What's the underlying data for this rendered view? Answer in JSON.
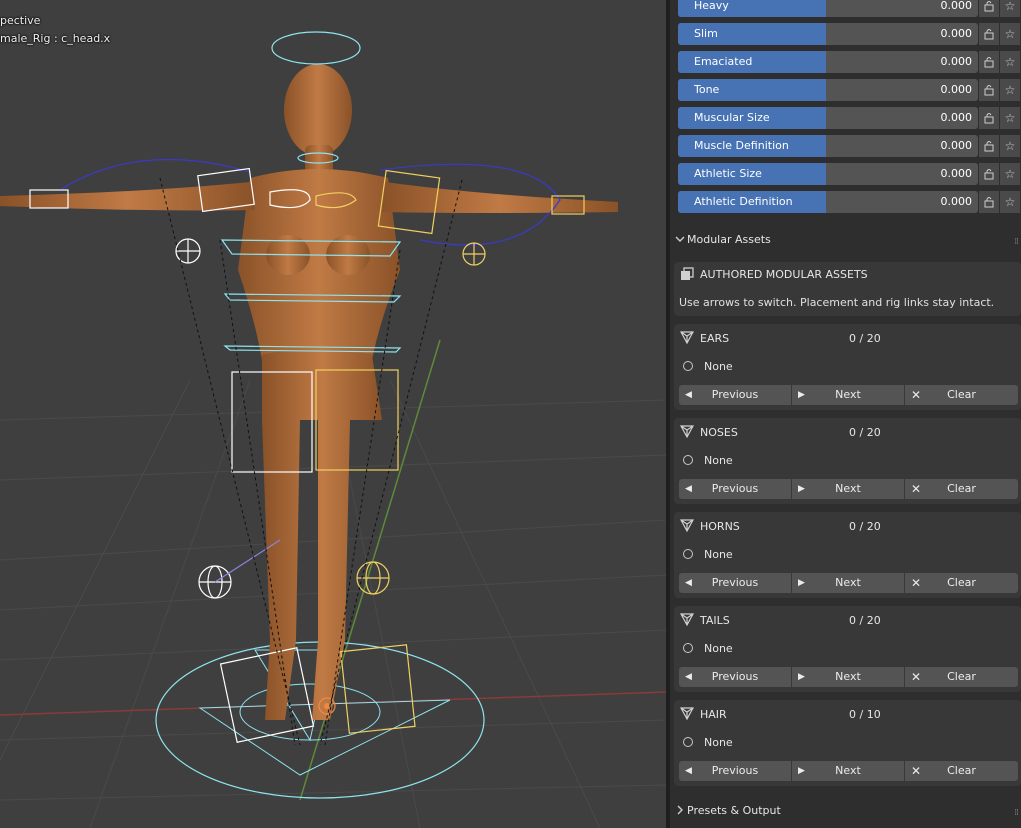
{
  "viewport": {
    "overlay_line1": "pective",
    "overlay_line2": "male_Rig : c_head.x"
  },
  "shape_sliders": [
    {
      "label": "Heavy",
      "value": "0.000"
    },
    {
      "label": "Slim",
      "value": "0.000"
    },
    {
      "label": "Emaciated",
      "value": "0.000"
    },
    {
      "label": "Tone",
      "value": "0.000"
    },
    {
      "label": "Muscular Size",
      "value": "0.000"
    },
    {
      "label": "Muscle Definition",
      "value": "0.000"
    },
    {
      "label": "Athletic Size",
      "value": "0.000"
    },
    {
      "label": "Athletic Definition",
      "value": "0.000"
    }
  ],
  "modular": {
    "header": "Modular Assets",
    "info_title": "AUTHORED MODULAR ASSETS",
    "info_text": "Use arrows to switch. Placement and rig links stay intact.",
    "categories": [
      {
        "name": "EARS",
        "count": "0 / 20",
        "selected": "None"
      },
      {
        "name": "NOSES",
        "count": "0 / 20",
        "selected": "None"
      },
      {
        "name": "HORNS",
        "count": "0 / 20",
        "selected": "None"
      },
      {
        "name": "TAILS",
        "count": "0 / 20",
        "selected": "None"
      },
      {
        "name": "HAIR",
        "count": "0 / 10",
        "selected": "None"
      }
    ],
    "prev_label": "Previous",
    "next_label": "Next",
    "clear_label": "Clear"
  },
  "presets": {
    "header": "Presets & Output"
  },
  "colors": {
    "accent": "#4772b3",
    "panel": "#2e2e2e",
    "viewport": "#3f3f3f"
  }
}
